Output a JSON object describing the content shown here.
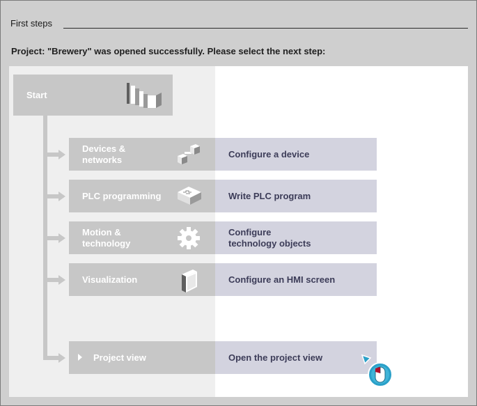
{
  "header": {
    "title": "First steps"
  },
  "status": {
    "message": "Project: \"Brewery\" was opened successfully. Please select the next step:"
  },
  "start": {
    "label": "Start"
  },
  "portals": [
    {
      "label": "Devices &\nnetworks",
      "icon": "devices-networks-icon",
      "action": "Configure a device"
    },
    {
      "label": "PLC programming",
      "icon": "plc-programming-icon",
      "action": "Write PLC program"
    },
    {
      "label": "Motion &\ntechnology",
      "icon": "gear-icon",
      "action": "Configure\ntechnology objects"
    },
    {
      "label": "Visualization",
      "icon": "hmi-screen-icon",
      "action": "Configure an HMI screen"
    }
  ],
  "project_view": {
    "label": "Project view",
    "action": "Open the project view"
  },
  "colors": {
    "portal_gray": "#c7c7c7",
    "action_lavender": "#d3d3df",
    "action_text": "#3c3c58",
    "cursor_teal": "#2aa0c8"
  }
}
